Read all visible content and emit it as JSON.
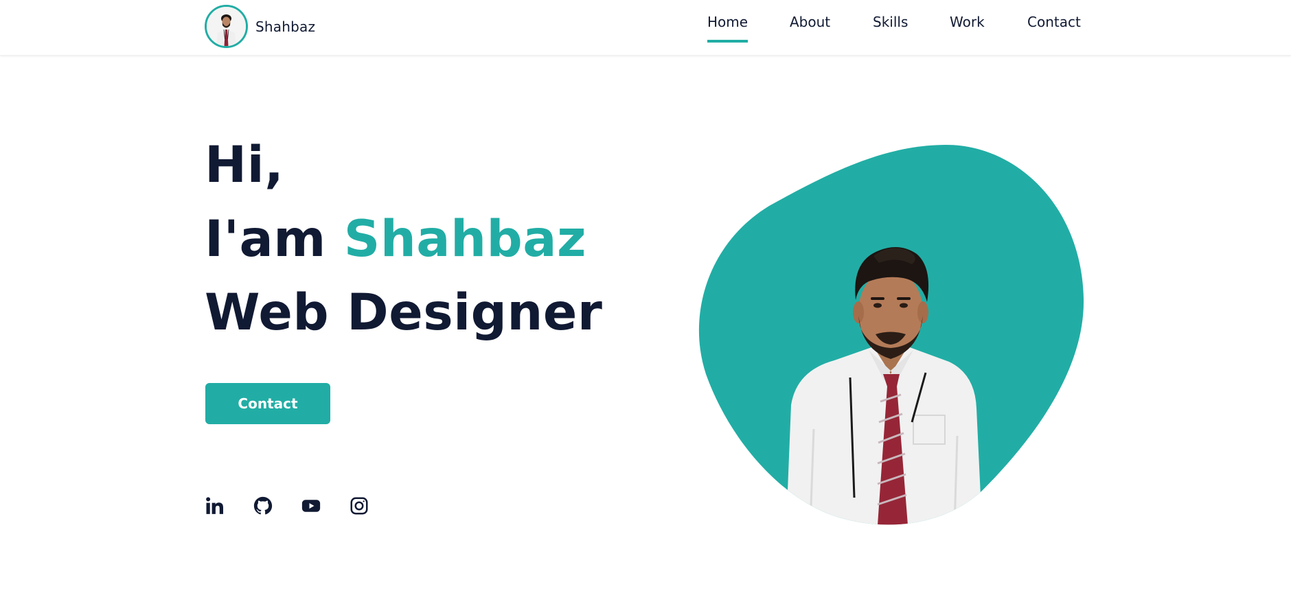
{
  "header": {
    "brand_name": "Shahbaz",
    "nav": [
      {
        "label": "Home",
        "active": true
      },
      {
        "label": "About",
        "active": false
      },
      {
        "label": "Skills",
        "active": false
      },
      {
        "label": "Work",
        "active": false
      },
      {
        "label": "Contact",
        "active": false
      }
    ]
  },
  "hero": {
    "greeting": "Hi,",
    "intro_prefix": "I'am ",
    "name": "Shahbaz",
    "role": "Web Designer",
    "cta_label": "Contact"
  },
  "socials": [
    {
      "icon": "linkedin-icon"
    },
    {
      "icon": "github-icon"
    },
    {
      "icon": "youtube-icon"
    },
    {
      "icon": "instagram-icon"
    }
  ],
  "colors": {
    "accent": "#21ada5",
    "text": "#111a33",
    "background": "#ffffff"
  }
}
